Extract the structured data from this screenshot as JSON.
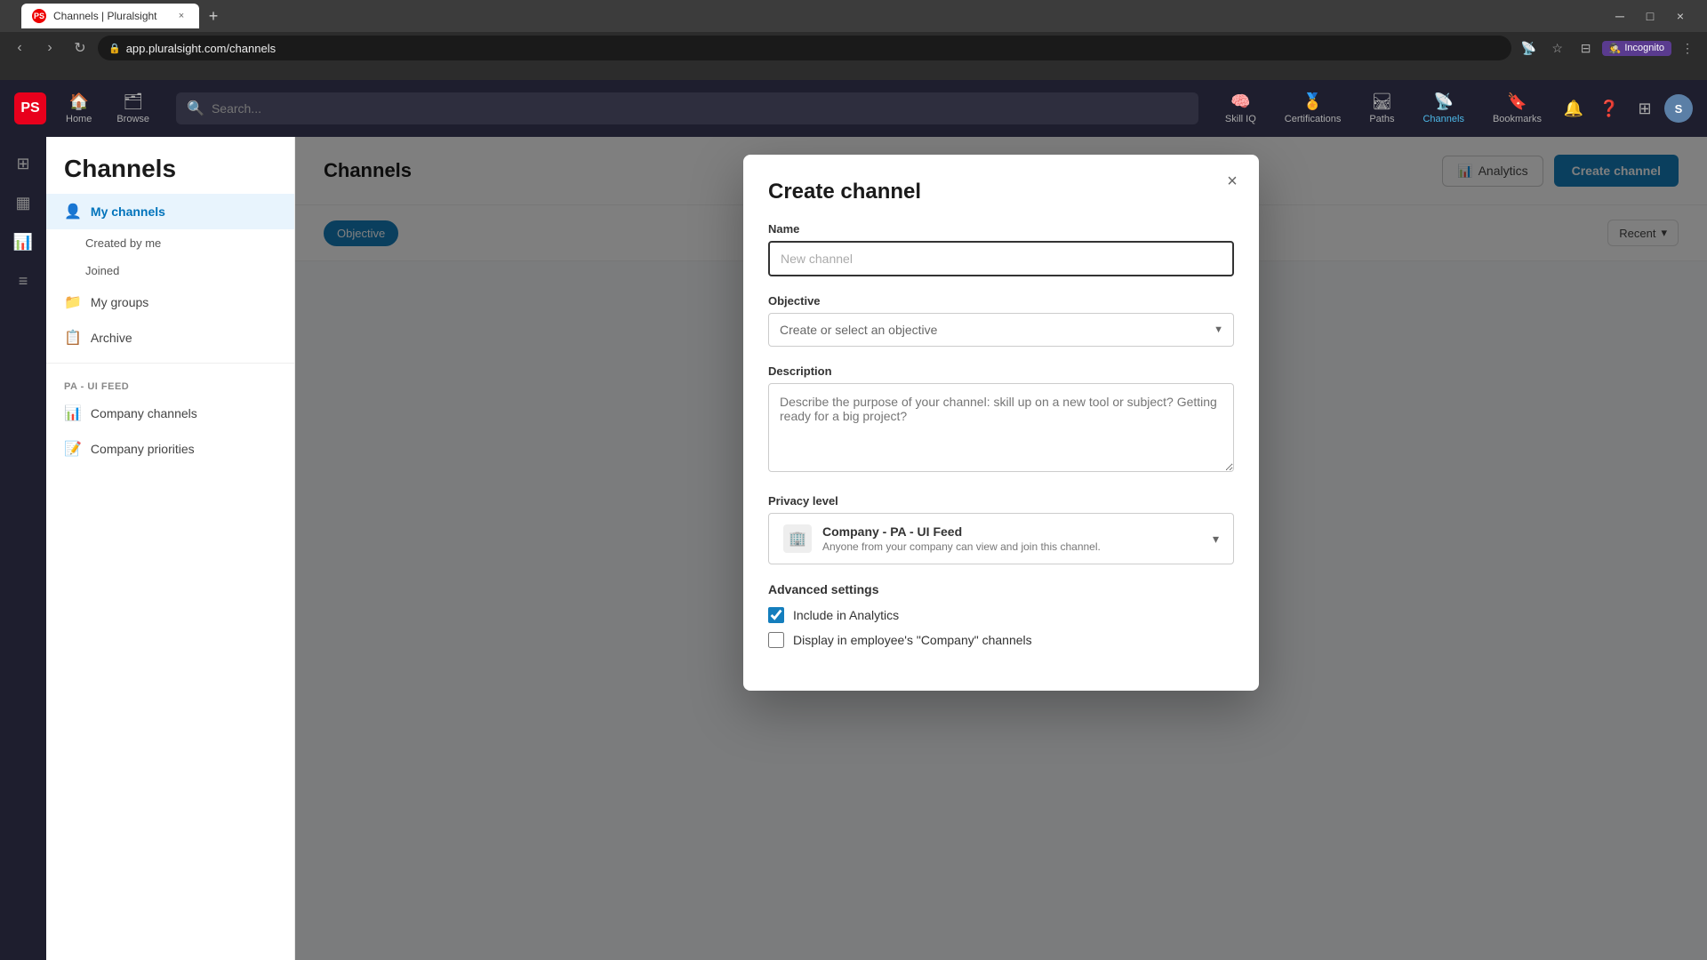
{
  "browser": {
    "tab_title": "Channels | Pluralsight",
    "tab_favicon": "PS",
    "url": "app.pluralsight.com/channels",
    "incognito_label": "Incognito"
  },
  "app": {
    "logo_text": "PS",
    "nav_items": [
      {
        "icon": "🏠",
        "label": "Home"
      },
      {
        "icon": "🗂",
        "label": "Browse"
      }
    ],
    "search_placeholder": "Search...",
    "right_nav": [
      {
        "icon": "🧠",
        "label": "Skill IQ"
      },
      {
        "icon": "🏅",
        "label": "Certifications"
      },
      {
        "icon": "🛤",
        "label": "Paths"
      },
      {
        "icon": "📡",
        "label": "Channels"
      },
      {
        "icon": "🔖",
        "label": "Bookmarks"
      }
    ]
  },
  "sidebar": {
    "title": "Channels",
    "nav_items": [
      {
        "id": "my-channels",
        "icon": "👤",
        "label": "My channels",
        "active": true
      },
      {
        "id": "created-by-me",
        "label": "Created by me",
        "sub": true
      },
      {
        "id": "joined",
        "label": "Joined",
        "sub": true
      },
      {
        "id": "my-groups",
        "icon": "📁",
        "label": "My groups",
        "active": false
      },
      {
        "id": "archive",
        "icon": "📋",
        "label": "Archive",
        "active": false
      }
    ],
    "section_label": "PA - UI FEED",
    "company_items": [
      {
        "id": "company-channels",
        "icon": "📊",
        "label": "Company channels"
      },
      {
        "id": "company-priorities",
        "icon": "📝",
        "label": "Company priorities"
      }
    ]
  },
  "content": {
    "header_title": "Channels",
    "analytics_label": "Analytics",
    "create_channel_label": "Create channel",
    "filter_objective_label": "Objective",
    "filter_recent_label": "Recent",
    "filter_recent_arrow": "▾"
  },
  "modal": {
    "title": "Create channel",
    "close_icon": "×",
    "name_label": "Name",
    "name_placeholder": "New channel",
    "objective_label": "Objective",
    "objective_placeholder": "Create or select an objective",
    "description_label": "Description",
    "description_placeholder": "Describe the purpose of your channel: skill up on a new tool or subject? Getting ready for a big project?",
    "privacy_label": "Privacy level",
    "privacy_name": "Company - PA - UI Feed",
    "privacy_desc": "Anyone from your company can view and join this channel.",
    "advanced_settings_label": "Advanced settings",
    "checkbox_analytics_label": "Include in Analytics",
    "checkbox_analytics_checked": true,
    "checkbox_display_label": "Display in employee's \"Company\" channels",
    "checkbox_display_checked": false
  },
  "icons": {
    "search": "🔍",
    "analytics": "📊",
    "building": "🏢",
    "chevron_down": "▾",
    "close": "×",
    "bell": "🔔",
    "help": "❓",
    "apps": "⊞",
    "lock": "🔒"
  }
}
